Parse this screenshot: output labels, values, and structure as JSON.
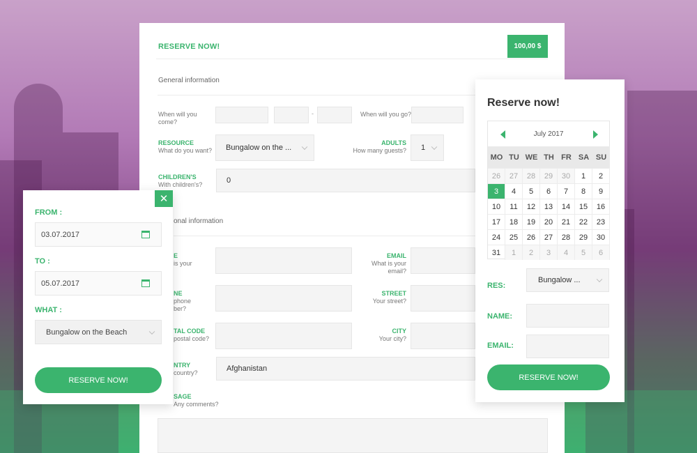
{
  "colors": {
    "accent": "#3bb46e",
    "panel": "#ffffff"
  },
  "main_form": {
    "title": "RESERVE NOW!",
    "price": "100,00 $",
    "general_section": "General information",
    "personal_section": "onal information",
    "come_label": "When will you come?",
    "come_l1": "When will you",
    "come_l2": "come?",
    "go_label": "When will you go?",
    "date_sep": "-",
    "resource": {
      "label": "RESOURCE",
      "sub": "What do you want?",
      "value": "Bungalow on the ..."
    },
    "adults": {
      "label": "ADULTS",
      "sub": "How many guests?",
      "value": "1"
    },
    "children": {
      "label": "CHILDREN'S",
      "sub": "With children's?",
      "value": "0"
    },
    "name": {
      "label": "E",
      "sub1": "is your",
      "sub2": ""
    },
    "email": {
      "label": "EMAIL",
      "sub1": "What is your",
      "sub2": "email?"
    },
    "phone": {
      "label": "NE",
      "sub1": "phone",
      "sub2": "ber?"
    },
    "street": {
      "label": "STREET",
      "sub": "Your street?"
    },
    "postal": {
      "label": "TAL CODE",
      "sub": "postal code?"
    },
    "city": {
      "label": "CITY",
      "sub": "Your city?"
    },
    "country": {
      "label": "NTRY",
      "sub": "country?",
      "value": "Afghanistan"
    },
    "message": {
      "label": "SAGE",
      "sub": "Any comments?"
    }
  },
  "left_widget": {
    "close_glyph": "✕",
    "from_label": "FROM :",
    "from_value": "03.07.2017",
    "to_label": "TO :",
    "to_value": "05.07.2017",
    "what_label": "WHAT :",
    "what_value": "Bungalow on the Beach",
    "button": "RESERVE NOW!"
  },
  "right_widget": {
    "title": "Reserve now!",
    "calendar": {
      "month": "July 2017",
      "weekdays": [
        "MO",
        "TU",
        "WE",
        "TH",
        "FR",
        "SA",
        "SU"
      ],
      "days": [
        {
          "d": "26",
          "m": true
        },
        {
          "d": "27",
          "m": true
        },
        {
          "d": "28",
          "m": true
        },
        {
          "d": "29",
          "m": true
        },
        {
          "d": "30",
          "m": true
        },
        {
          "d": "1"
        },
        {
          "d": "2"
        },
        {
          "d": "3",
          "s": true
        },
        {
          "d": "4"
        },
        {
          "d": "5"
        },
        {
          "d": "6"
        },
        {
          "d": "7"
        },
        {
          "d": "8"
        },
        {
          "d": "9"
        },
        {
          "d": "10"
        },
        {
          "d": "11"
        },
        {
          "d": "12"
        },
        {
          "d": "13"
        },
        {
          "d": "14"
        },
        {
          "d": "15"
        },
        {
          "d": "16"
        },
        {
          "d": "17"
        },
        {
          "d": "18"
        },
        {
          "d": "19"
        },
        {
          "d": "20"
        },
        {
          "d": "21"
        },
        {
          "d": "22"
        },
        {
          "d": "23"
        },
        {
          "d": "24"
        },
        {
          "d": "25"
        },
        {
          "d": "26"
        },
        {
          "d": "27"
        },
        {
          "d": "28"
        },
        {
          "d": "29"
        },
        {
          "d": "30"
        },
        {
          "d": "31"
        },
        {
          "d": "1",
          "m": true
        },
        {
          "d": "2",
          "m": true
        },
        {
          "d": "3",
          "m": true
        },
        {
          "d": "4",
          "m": true
        },
        {
          "d": "5",
          "m": true
        },
        {
          "d": "6",
          "m": true
        }
      ]
    },
    "res_label": "RES:",
    "res_value": "Bungalow ...",
    "name_label": "NAME:",
    "email_label": "EMAIL:",
    "button": "RESERVE NOW!"
  }
}
